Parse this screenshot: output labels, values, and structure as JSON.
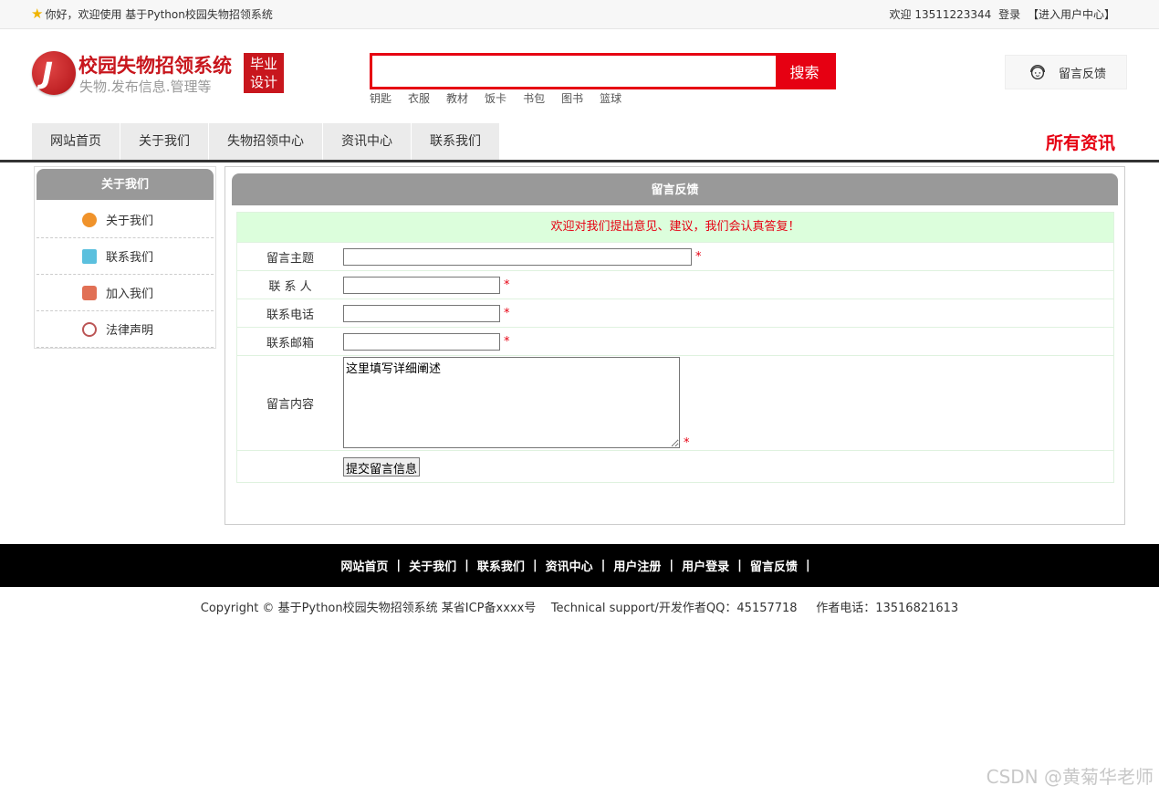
{
  "topbar": {
    "greeting": "你好，欢迎使用 基于Python校园失物招领系统",
    "welcome_user": "欢迎 13511223344",
    "login": "登录",
    "user_center": "【进入用户中心】"
  },
  "header": {
    "logo_title": "校园失物招领系统",
    "logo_sub": "失物.发布信息.管理等",
    "logo_tag_line1": "毕业",
    "logo_tag_line2": "设计",
    "search_button": "搜索",
    "search_value": "",
    "hot_words": [
      "钥匙",
      "衣服",
      "教材",
      "饭卡",
      "书包",
      "图书",
      "篮球"
    ],
    "feedback_button": "留言反馈"
  },
  "nav": {
    "items": [
      "网站首页",
      "关于我们",
      "失物招领中心",
      "资讯中心",
      "联系我们"
    ],
    "all_news": "所有资讯"
  },
  "sidebar": {
    "title": "关于我们",
    "items": [
      "关于我们",
      "联系我们",
      "加入我们",
      "法律声明"
    ]
  },
  "main": {
    "title": "留言反馈",
    "welcome": "欢迎对我们提出意见、建议，我们会认真答复！",
    "fields": {
      "subject_label": "留言主题",
      "contact_label": "联 系 人",
      "phone_label": "联系电话",
      "email_label": "联系邮箱",
      "content_label": "留言内容",
      "content_value": "这里填写详细阐述",
      "required_mark": "*"
    },
    "submit": "提交留言信息"
  },
  "footer": {
    "links": [
      "网站首页",
      "关于我们",
      "联系我们",
      "资讯中心",
      "用户注册",
      "用户登录",
      "留言反馈"
    ],
    "separator": "|",
    "copyright": "Copyright © 基于Python校园失物招领系统 某省ICP备xxxx号    Technical support/开发作者QQ：45157718     作者电话：13516821613"
  },
  "watermark": "CSDN @黄菊华老师",
  "colors": {
    "accent": "#e60012",
    "brand_red": "#c8161d",
    "panel_gray": "#999999",
    "welcome_bg": "#dcfedc"
  }
}
